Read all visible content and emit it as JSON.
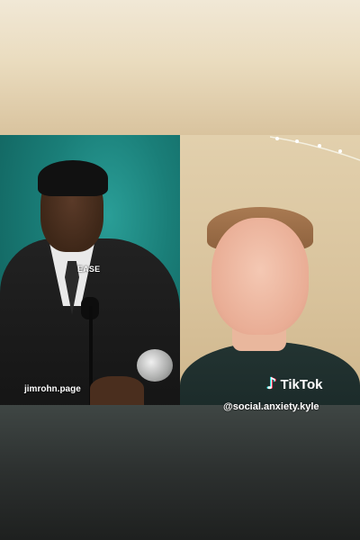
{
  "video": {
    "left_caption": "EASE",
    "left_watermark": "jimrohn.page",
    "tiktok_wordmark": "TikTok",
    "tiktok_handle": "@social.anxiety.kyle"
  },
  "icons": {
    "tiktok": "tiktok-note-icon"
  },
  "colors": {
    "left_bg": "#1a7e78",
    "right_bg": "#d8c29b",
    "bottom_bg": "#2c302f"
  }
}
